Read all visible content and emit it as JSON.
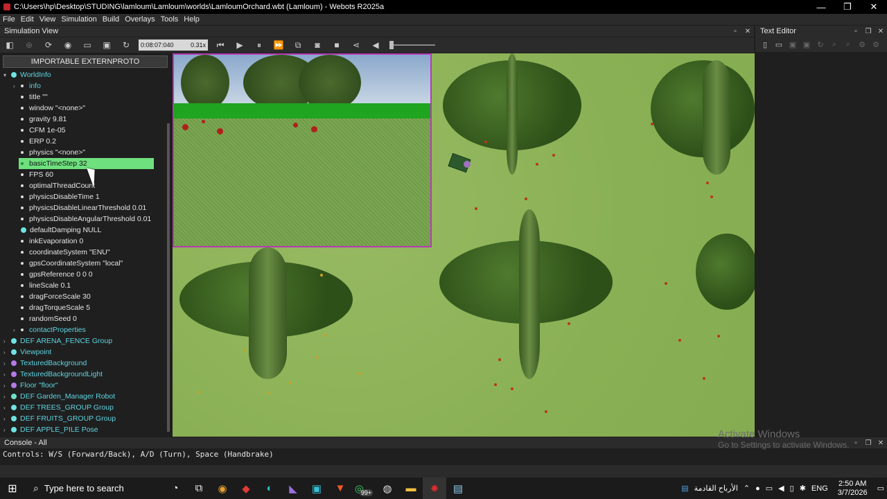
{
  "window": {
    "title": "C:\\Users\\hp\\Desktop\\STUDING\\lamloum\\Lamloum\\worlds\\LamloumOrchard.wbt (Lamloum) - Webots R2025a",
    "minimize": "—",
    "maximize": "❐",
    "close": "✕"
  },
  "menu": [
    "File",
    "Edit",
    "View",
    "Simulation",
    "Build",
    "Overlays",
    "Tools",
    "Help"
  ],
  "sim_view": {
    "label": "Simulation View",
    "time": "0:08:07:040",
    "speed": "0.31x"
  },
  "tree": {
    "importable": "IMPORTABLE EXTERNPROTO",
    "root": "WorldInfo",
    "fields": [
      {
        "label": "info",
        "teal": true,
        "expandable": true
      },
      {
        "label": "title \"\""
      },
      {
        "label": "window \"<none>\""
      },
      {
        "label": "gravity 9.81"
      },
      {
        "label": "CFM 1e-05"
      },
      {
        "label": "ERP 0.2"
      },
      {
        "label": "physics \"<none>\""
      },
      {
        "label": "basicTimeStep 32",
        "selected": true
      },
      {
        "label": "FPS 60"
      },
      {
        "label": "optimalThreadCount"
      },
      {
        "label": "physicsDisableTime 1"
      },
      {
        "label": "physicsDisableLinearThreshold 0.01"
      },
      {
        "label": "physicsDisableAngularThreshold 0.01"
      },
      {
        "label": "defaultDamping NULL",
        "node": true
      },
      {
        "label": "inkEvaporation 0"
      },
      {
        "label": "coordinateSystem \"ENU\""
      },
      {
        "label": "gpsCoordinateSystem \"local\""
      },
      {
        "label": "gpsReference 0 0 0"
      },
      {
        "label": "lineScale 0.1"
      },
      {
        "label": "dragForceScale 30"
      },
      {
        "label": "dragTorqueScale 5"
      },
      {
        "label": "randomSeed 0"
      },
      {
        "label": "contactProperties",
        "teal": true,
        "expandable": true
      }
    ],
    "nodes": [
      {
        "label": "DEF ARENA_FENCE Group",
        "dot": "cyan"
      },
      {
        "label": "Viewpoint",
        "dot": "cyan"
      },
      {
        "label": "TexturedBackground",
        "dot": "purple"
      },
      {
        "label": "TexturedBackgroundLight",
        "dot": "purple"
      },
      {
        "label": "Floor \"floor\"",
        "dot": "purple"
      },
      {
        "label": "DEF Garden_Manager Robot",
        "dot": "greenblue"
      },
      {
        "label": "DEF TREES_GROUP Group",
        "dot": "cyan"
      },
      {
        "label": "DEF FRUITS_GROUP Group",
        "dot": "cyan"
      },
      {
        "label": "DEF APPLE_PILE Pose",
        "dot": "cyan"
      }
    ]
  },
  "text_editor": {
    "label": "Text Editor"
  },
  "console": {
    "label": "Console - All",
    "output": "Controls: W/S (Forward/Back), A/D (Turn), Space (Handbrake)"
  },
  "activate": {
    "line1": "Activate Windows",
    "line2": "Go to Settings to activate Windows."
  },
  "taskbar": {
    "search_placeholder": "Type here to search",
    "news": "الأرباح القادمة",
    "lang": "ENG",
    "time": "2:50 AM",
    "date": "3/7/2026",
    "badge": "99+"
  }
}
